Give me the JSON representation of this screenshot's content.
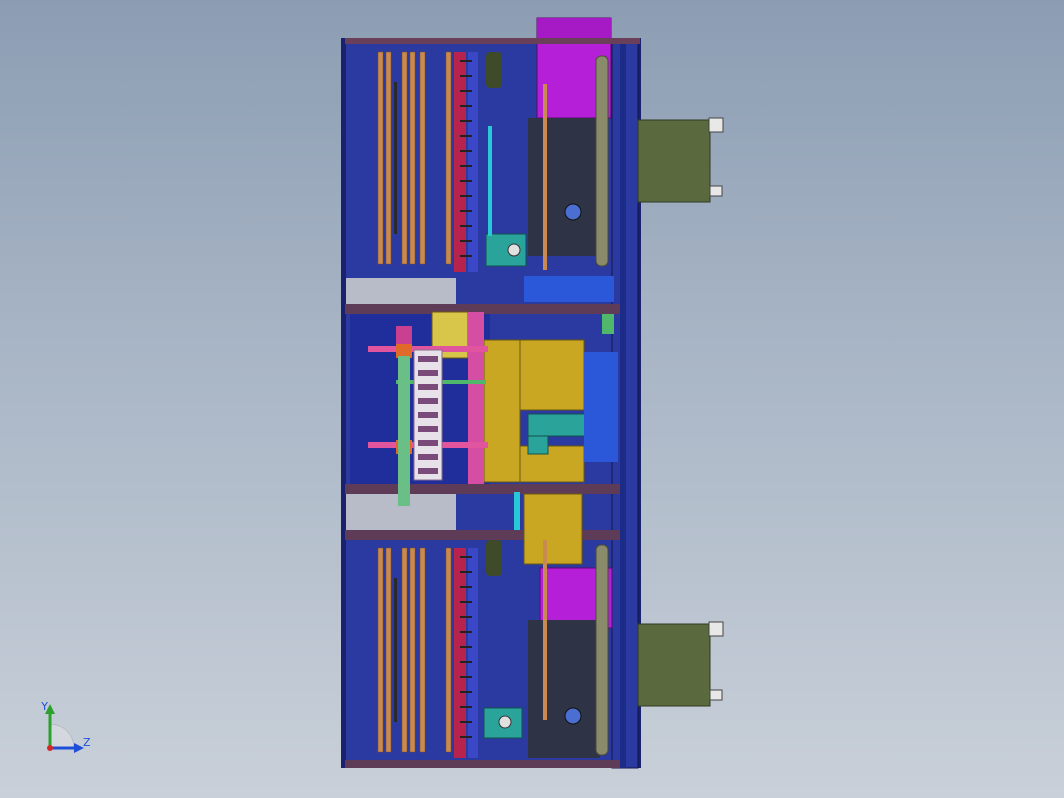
{
  "triad": {
    "y_label": "Y",
    "z_label": "Z",
    "y_color": "#2ca02c",
    "z_color": "#1f4fd8",
    "origin_color": "#d62728"
  },
  "colors": {
    "frame_blue": "#2b3aa0",
    "frame_dark": "#1a2270",
    "magenta": "#b51fd8",
    "olive": "#5b6a3e",
    "yellow": "#c9a722",
    "teal": "#2aa39a",
    "copper": "#c98a52",
    "crimson": "#b8234e",
    "pink": "#d64ea3",
    "gray_panel": "#b8bcc8",
    "dark_block": "#2e3346",
    "roller": "#8a8b6a",
    "cyan": "#28c8d8",
    "green": "#4fb86b"
  }
}
